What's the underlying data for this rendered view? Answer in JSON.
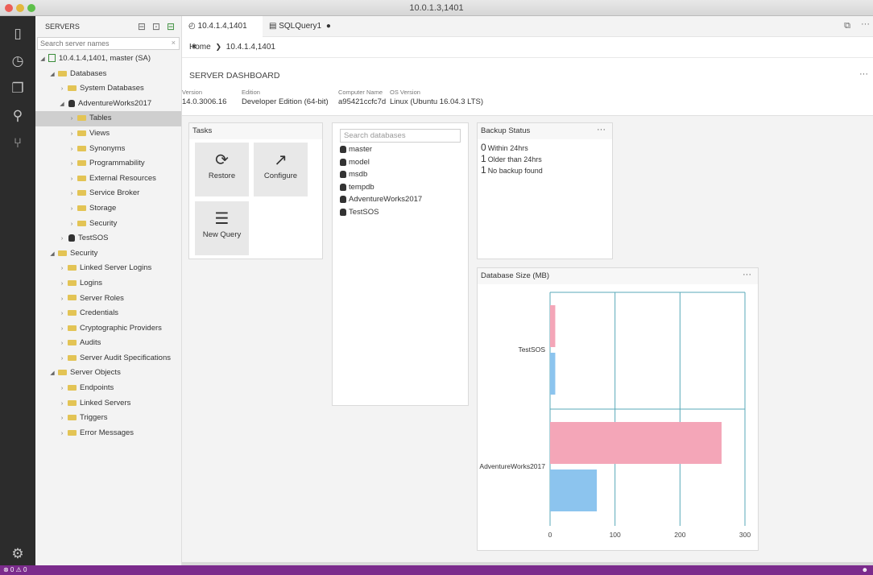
{
  "window": {
    "title": "10.0.1.3,1401"
  },
  "sidebar": {
    "header": "SERVERS",
    "search_placeholder": "Search server names",
    "search_clear": "×",
    "tree": [
      {
        "label": "10.4.1.4,1401, master (SA)",
        "icon": "server-icon",
        "twisty": "◢",
        "level": 0
      },
      {
        "label": "Databases",
        "icon": "folder-icon",
        "twisty": "◢",
        "level": 1
      },
      {
        "label": "System Databases",
        "icon": "folder-icon",
        "twisty": "›",
        "level": 2
      },
      {
        "label": "AdventureWorks2017",
        "icon": "database-icon",
        "twisty": "◢",
        "level": 2
      },
      {
        "label": "Tables",
        "icon": "folder-icon",
        "twisty": "›",
        "level": 3,
        "selected": true
      },
      {
        "label": "Views",
        "icon": "folder-icon",
        "twisty": "›",
        "level": 3
      },
      {
        "label": "Synonyms",
        "icon": "folder-icon",
        "twisty": "›",
        "level": 3
      },
      {
        "label": "Programmability",
        "icon": "folder-icon",
        "twisty": "›",
        "level": 3
      },
      {
        "label": "External Resources",
        "icon": "folder-icon",
        "twisty": "›",
        "level": 3
      },
      {
        "label": "Service Broker",
        "icon": "folder-icon",
        "twisty": "›",
        "level": 3
      },
      {
        "label": "Storage",
        "icon": "folder-icon",
        "twisty": "›",
        "level": 3
      },
      {
        "label": "Security",
        "icon": "folder-icon",
        "twisty": "›",
        "level": 3
      },
      {
        "label": "TestSOS",
        "icon": "database-icon",
        "twisty": "›",
        "level": 2
      },
      {
        "label": "Security",
        "icon": "folder-icon",
        "twisty": "◢",
        "level": 1
      },
      {
        "label": "Linked Server Logins",
        "icon": "folder-icon",
        "twisty": "›",
        "level": 2
      },
      {
        "label": "Logins",
        "icon": "folder-icon",
        "twisty": "›",
        "level": 2
      },
      {
        "label": "Server Roles",
        "icon": "folder-icon",
        "twisty": "›",
        "level": 2
      },
      {
        "label": "Credentials",
        "icon": "folder-icon",
        "twisty": "›",
        "level": 2
      },
      {
        "label": "Cryptographic Providers",
        "icon": "folder-icon",
        "twisty": "›",
        "level": 2
      },
      {
        "label": "Audits",
        "icon": "folder-icon",
        "twisty": "›",
        "level": 2
      },
      {
        "label": "Server Audit Specifications",
        "icon": "folder-icon",
        "twisty": "›",
        "level": 2
      },
      {
        "label": "Server Objects",
        "icon": "folder-icon",
        "twisty": "◢",
        "level": 1
      },
      {
        "label": "Endpoints",
        "icon": "folder-icon",
        "twisty": "›",
        "level": 2
      },
      {
        "label": "Linked Servers",
        "icon": "folder-icon",
        "twisty": "›",
        "level": 2
      },
      {
        "label": "Triggers",
        "icon": "folder-icon",
        "twisty": "›",
        "level": 2
      },
      {
        "label": "Error Messages",
        "icon": "folder-icon",
        "twisty": "›",
        "level": 2
      }
    ]
  },
  "tabs": [
    {
      "label": "10.4.1.4,1401",
      "close": "×"
    },
    {
      "label": "SQLQuery1",
      "close": "●"
    }
  ],
  "breadcrumb": {
    "home": "Home",
    "separator": "❯",
    "current": "10.4.1.4,1401"
  },
  "dashboard": {
    "title": "SERVER DASHBOARD",
    "more": "···",
    "properties": [
      {
        "key": "Version",
        "value": "14.0.3006.16"
      },
      {
        "key": "Edition",
        "value": "Developer Edition (64-bit)"
      },
      {
        "key": "Computer Name",
        "value": "a95421ccfc7d"
      },
      {
        "key": "OS Version",
        "value": "Linux (Ubuntu 16.04.3 LTS)"
      }
    ]
  },
  "tasks": {
    "title": "Tasks",
    "items": [
      {
        "label": "Restore",
        "icon": "restore-icon"
      },
      {
        "label": "Configure",
        "icon": "configure-icon"
      },
      {
        "label": "New Query",
        "icon": "new-query-icon"
      }
    ]
  },
  "databases": {
    "search_placeholder": "Search databases",
    "items": [
      "master",
      "model",
      "msdb",
      "tempdb",
      "AdventureWorks2017",
      "TestSOS"
    ]
  },
  "backup": {
    "title": "Backup Status",
    "more": "···",
    "rows": [
      {
        "count": "0",
        "text": "Within 24hrs"
      },
      {
        "count": "1",
        "text": "Older than 24hrs"
      },
      {
        "count": "1",
        "text": "No backup found"
      }
    ]
  },
  "dbsize": {
    "title": "Database Size (MB)",
    "more": "···"
  },
  "chart_data": {
    "type": "bar",
    "orientation": "horizontal",
    "title": "Database Size (MB)",
    "categories": [
      "TestSOS",
      "AdventureWorks2017"
    ],
    "series": [
      {
        "values": [
          8,
          264
        ],
        "color": "#f4a6b8"
      },
      {
        "values": [
          8,
          72
        ],
        "color": "#8cc4ee"
      }
    ],
    "xlim": [
      0,
      300
    ],
    "xticks": [
      "0",
      "100",
      "200",
      "300"
    ],
    "grid": true
  },
  "statusbar": {
    "left": "⊗ 0  ⚠ 0"
  },
  "colors": {
    "accent": "#7b2b8c",
    "selection": "#cfcfcf",
    "folder": "#e3c455"
  }
}
